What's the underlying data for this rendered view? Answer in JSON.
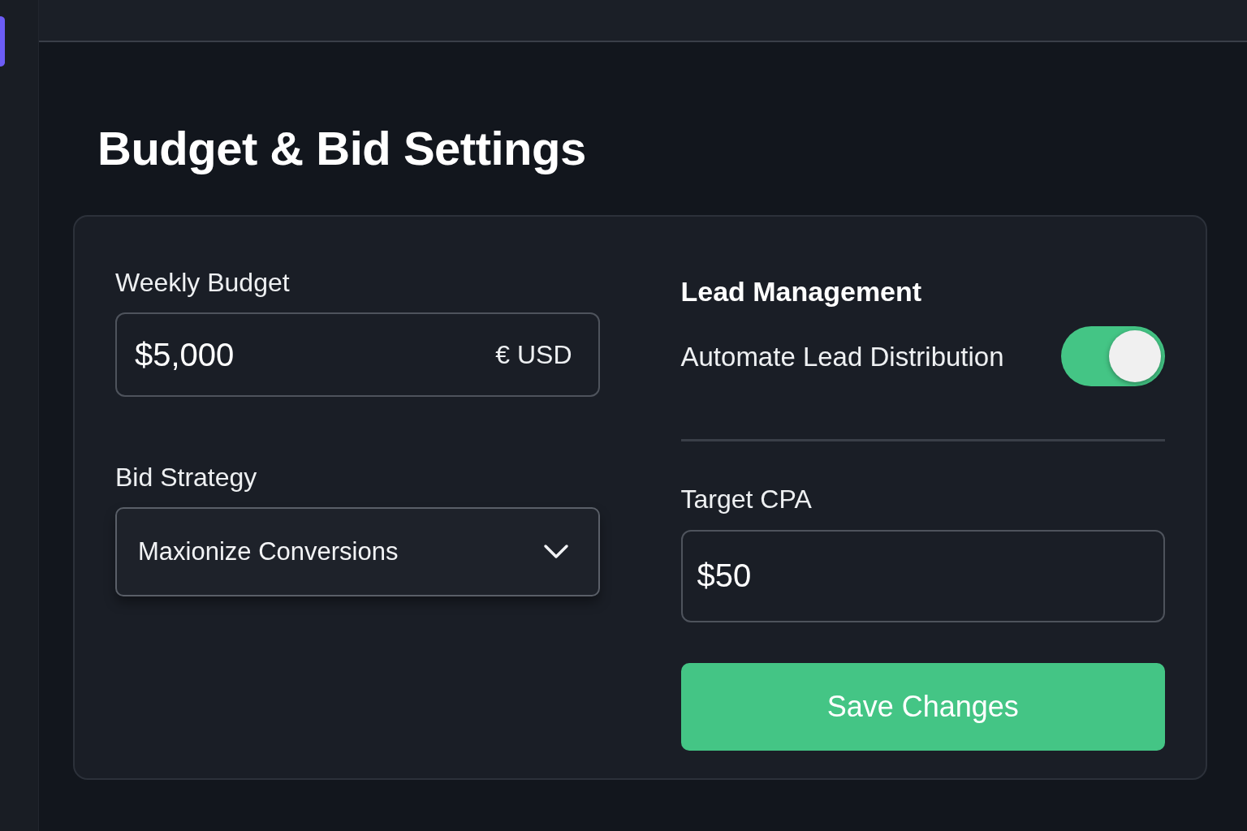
{
  "page_title": "Budget & Bid Settings",
  "settings_card": {
    "weekly_budget": {
      "label": "Weekly Budget",
      "value": "$5,000",
      "currency": "€ USD"
    },
    "bid_strategy": {
      "label": "Bid Strategy",
      "value": "Maxionize Conversions"
    },
    "lead_management": {
      "heading": "Lead Management",
      "automate_lead_distribution": {
        "label": "Automate Lead Distribution",
        "on": true
      }
    },
    "target_cpa": {
      "label": "Target CPA",
      "value": "$50"
    },
    "save_button": {
      "label": "Save Changes"
    }
  }
}
